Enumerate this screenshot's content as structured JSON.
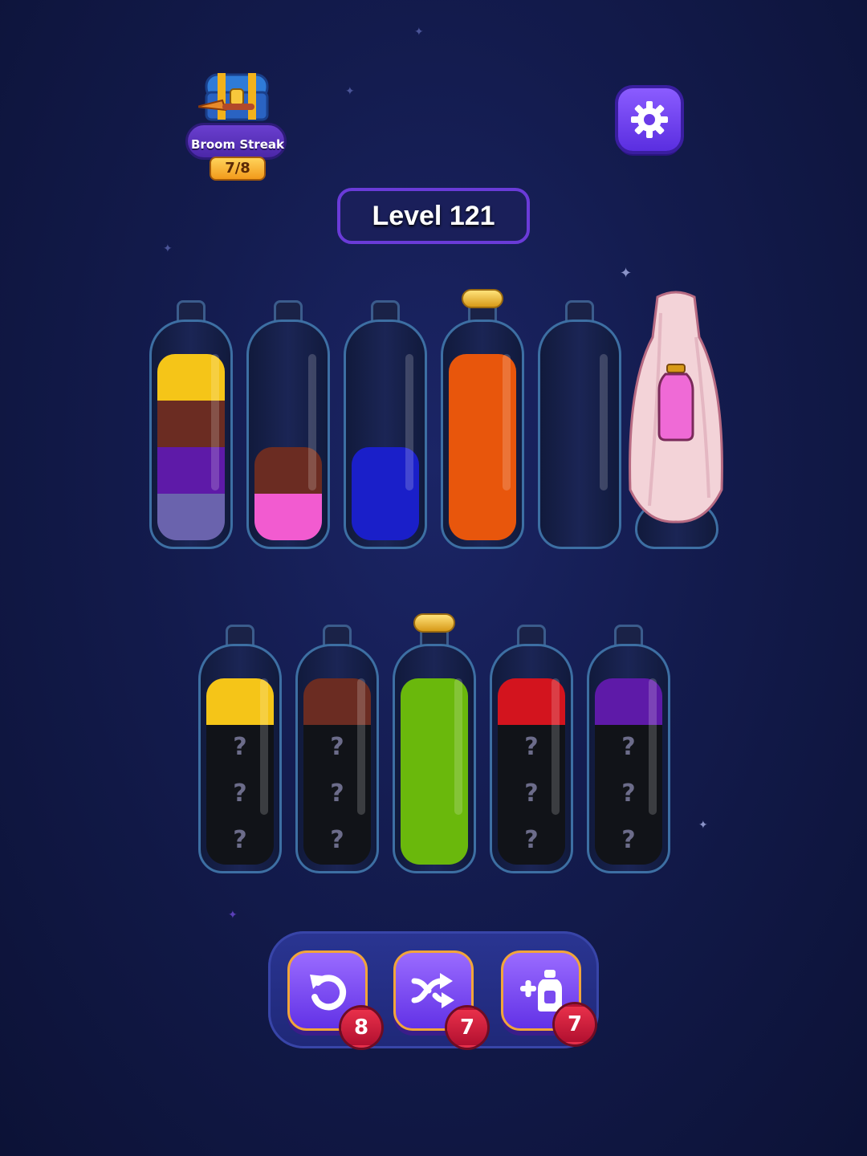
{
  "streak": {
    "title": "Broom Streak",
    "progress": "7/8"
  },
  "level": {
    "label": "Level 121"
  },
  "icons": {
    "settings": "gear-icon",
    "undo": "undo-icon",
    "shuffle": "shuffle-icon",
    "add_bottle": "add-bottle-icon"
  },
  "colors": {
    "yellow": "#f5c518",
    "brown": "#6b2c22",
    "purple": "#5e1aa8",
    "lavender": "#6a63ad",
    "pink": "#f25bd0",
    "blue": "#1a1fc9",
    "orange": "#e8560c",
    "green": "#6ab80c",
    "red": "#d3141e",
    "hidden": "#111318"
  },
  "top_row": [
    {
      "layers": [
        "lavender",
        "purple",
        "brown",
        "yellow"
      ],
      "capped": false
    },
    {
      "layers": [
        "pink",
        "brown"
      ],
      "capped": false
    },
    {
      "layers": [
        "blue",
        "blue"
      ],
      "capped": false
    },
    {
      "layers": [
        "orange",
        "orange",
        "orange",
        "orange"
      ],
      "capped": true
    },
    {
      "layers": [],
      "capped": false
    },
    {
      "covered": true
    }
  ],
  "bottom_row": [
    {
      "layers": [
        "hidden",
        "hidden",
        "hidden",
        "yellow"
      ],
      "capped": false
    },
    {
      "layers": [
        "hidden",
        "hidden",
        "hidden",
        "brown"
      ],
      "capped": false
    },
    {
      "layers": [
        "green",
        "green",
        "green",
        "green"
      ],
      "capped": true
    },
    {
      "layers": [
        "hidden",
        "hidden",
        "hidden",
        "red"
      ],
      "capped": false
    },
    {
      "layers": [
        "hidden",
        "hidden",
        "hidden",
        "purple"
      ],
      "capped": false
    }
  ],
  "hidden_mark": "?",
  "tools": [
    {
      "name": "undo",
      "count": "8"
    },
    {
      "name": "shuffle",
      "count": "7"
    },
    {
      "name": "add_bottle",
      "count": "7"
    }
  ]
}
